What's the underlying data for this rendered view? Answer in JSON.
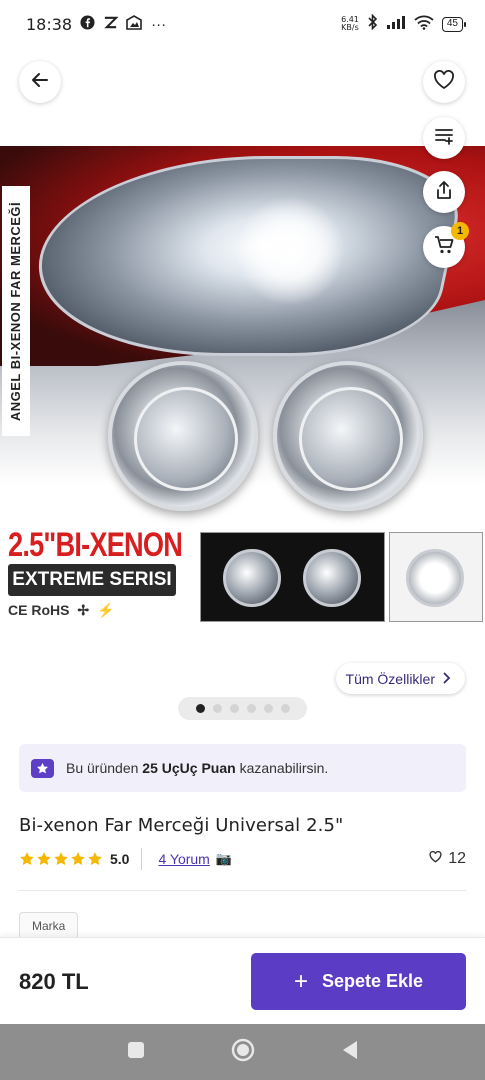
{
  "status_bar": {
    "time": "18:38",
    "more": "···",
    "net_speed_value": "6.41",
    "net_speed_unit": "KB/s",
    "battery": "45"
  },
  "product_image": {
    "side_banner": "ANGEL BI-XENON FAR MERCEĞİ",
    "headline": "2.5\"BI-XENON",
    "subheadline": "EXTREME SERISI",
    "certifications": "CE RoHS"
  },
  "carousel": {
    "count": 6,
    "active_index": 0
  },
  "all_features_label": "Tüm Özellikler",
  "points_banner": {
    "prefix": "Bu üründen",
    "highlight": "25 UçUç Puan",
    "suffix": "kazanabilirsin."
  },
  "product": {
    "title": "Bi-xenon Far Merceği Universal 2.5\"",
    "rating": "5.0",
    "stars": 5,
    "reviews_label": "4 Yorum",
    "likes": "12",
    "brand_tag": "Marka"
  },
  "bottom_bar": {
    "price": "820 TL",
    "add_to_cart_label": "Sepete Ekle"
  },
  "cart": {
    "badge_count": "1"
  },
  "colors": {
    "accent": "#5b3cc4",
    "star": "#f5b800",
    "banner_bg": "#f1effa"
  }
}
